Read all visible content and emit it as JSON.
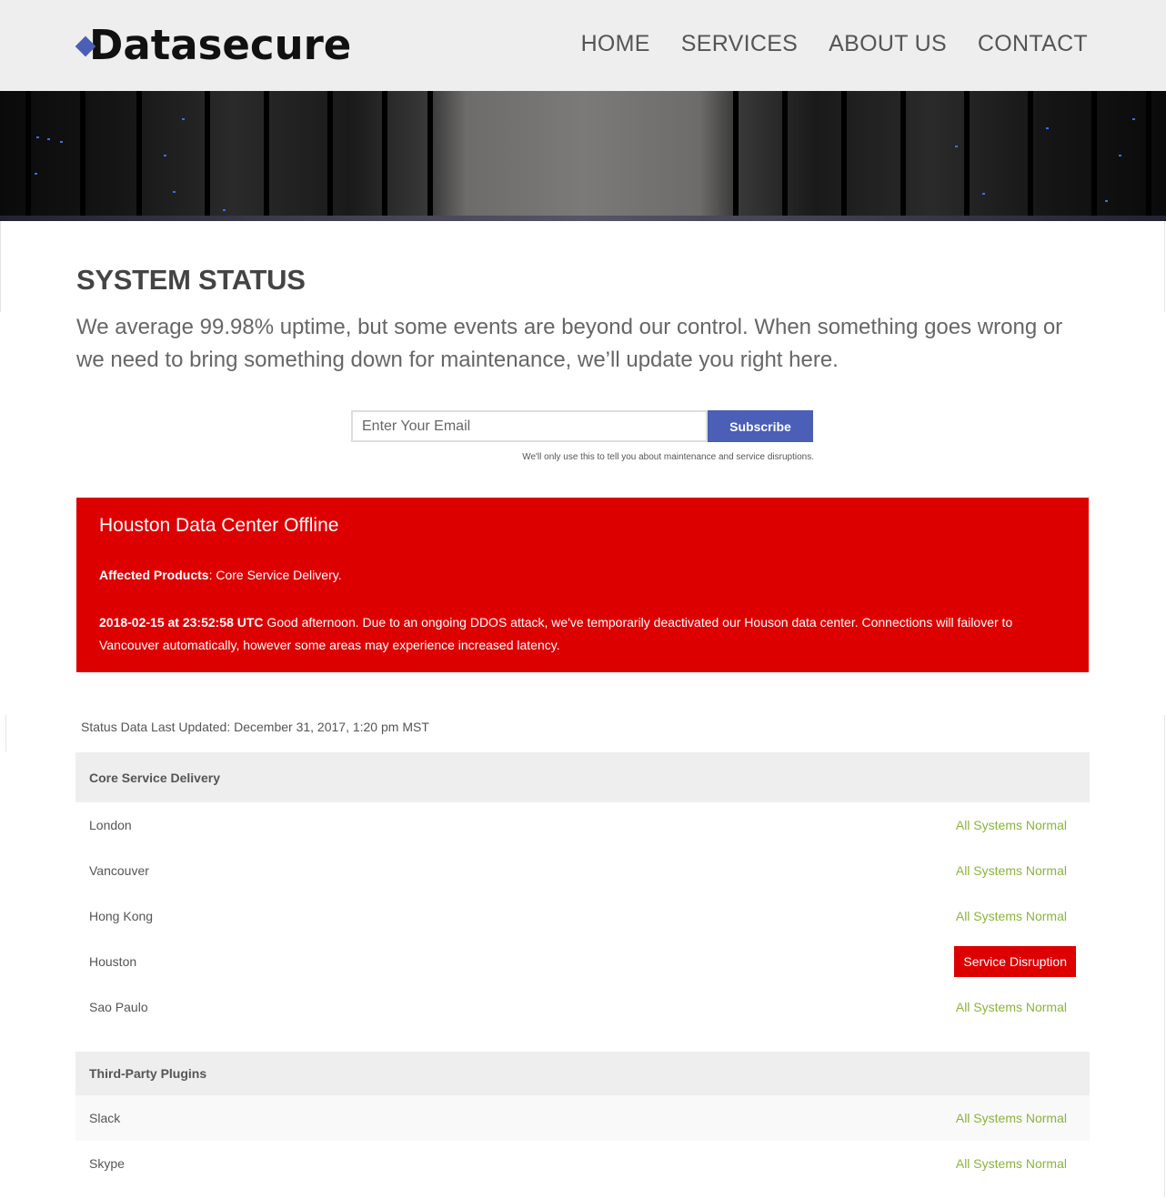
{
  "header": {
    "logo_text": "Datasecure",
    "nav": [
      "HOME",
      "SERVICES",
      "ABOUT US",
      "CONTACT"
    ]
  },
  "colors": {
    "accent": "#4a5fb5",
    "alert": "#dd0000",
    "normal": "#8ab43a",
    "header_bg": "#eeeeee"
  },
  "main": {
    "title": "SYSTEM STATUS",
    "intro": "We average 99.98% uptime, but some events are beyond our control. When something goes wrong or we need to bring something down for maintenance, we’ll update you right here.",
    "subscribe": {
      "placeholder": "Enter Your Email",
      "button": "Subscribe",
      "note": "We'll only use this to tell you about maintenance and service disruptions."
    },
    "alert": {
      "title": "Houston Data Center Offline",
      "affected_label": "Affected Products",
      "affected_value": ": Core Service Delivery.",
      "timestamp": "2018-02-15 at 23:52:58 UTC",
      "message": " Good afternoon. Due to an ongoing DDOS attack, we've temporarily deactivated our Houson data center. Connections will failover to Vancouver automatically, however some areas may experience increased latency."
    },
    "last_updated": "Status Data Last Updated: December 31, 2017, 1:20 pm MST",
    "groups": [
      {
        "name": "Core Service Delivery",
        "rows": [
          {
            "label": "London",
            "status": "All Systems Normal"
          },
          {
            "label": "Vancouver",
            "status": "All Systems Normal"
          },
          {
            "label": "Hong Kong",
            "status": "All Systems Normal"
          },
          {
            "label": "Houston",
            "status": "Service Disruption"
          },
          {
            "label": "Sao Paulo",
            "status": "All Systems Normal"
          }
        ]
      },
      {
        "name": "Third-Party Plugins",
        "rows": [
          {
            "label": "Slack",
            "status": "All Systems Normal"
          },
          {
            "label": "Skype",
            "status": "All Systems Normal"
          }
        ]
      }
    ]
  }
}
